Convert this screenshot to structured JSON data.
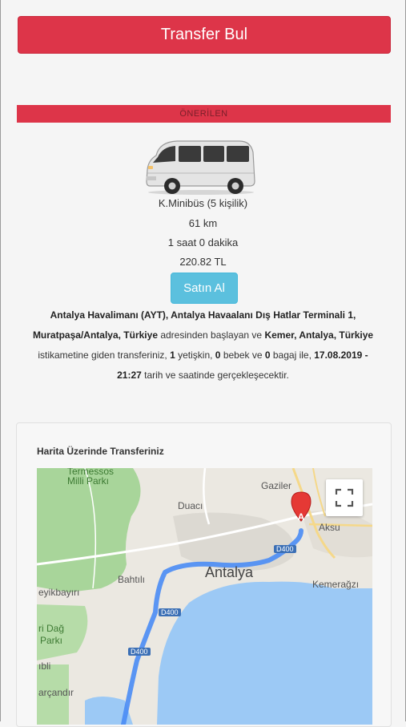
{
  "header": {
    "find_button": "Transfer Bul"
  },
  "recommended": {
    "label": "ÖNERİLEN",
    "vehicle_name": "K.Minibüs (5 kişilik)",
    "distance": "61 km",
    "duration": "1 saat 0 dakika",
    "price": "220.82 TL",
    "buy_button": "Satın Al"
  },
  "summary": {
    "origin": "Antalya Havalimanı (AYT), Antalya Havaalanı Dış Hatlar Terminali 1, Muratpaşa/Antalya, Türkiye",
    "t1": " adresinden başlayan ve ",
    "destination": "Kemer, Antalya, Türkiye",
    "t2": " istikametine giden transferiniz, ",
    "adults": "1",
    "t3": " yetişkin, ",
    "infants": "0",
    "t4": " bebek ve ",
    "bags": "0",
    "t5": " bagaj ile, ",
    "datetime": "17.08.2019 - 21:27",
    "t6": " tarih ve saatinde gerçekleşecektir."
  },
  "map": {
    "title": "Harita Üzerinde Transferiniz",
    "labels": {
      "termessos": "Termessos",
      "milli_parki": "Milli Parkı",
      "gaziler": "Gaziler",
      "duaci": "Duacı",
      "aksu": "Aksu",
      "bahtili": "Bahtılı",
      "antalya": "Antalya",
      "kemeragzi": "Kemerağzı",
      "beyikbayiri": "eyikbayırı",
      "ri_dag": "ri Dağ",
      "parki": "Parkı",
      "ibli": "ıbli",
      "carcandir": "arçandır",
      "marker": "A"
    },
    "road_labels": [
      "D400",
      "D400",
      "D400"
    ]
  }
}
